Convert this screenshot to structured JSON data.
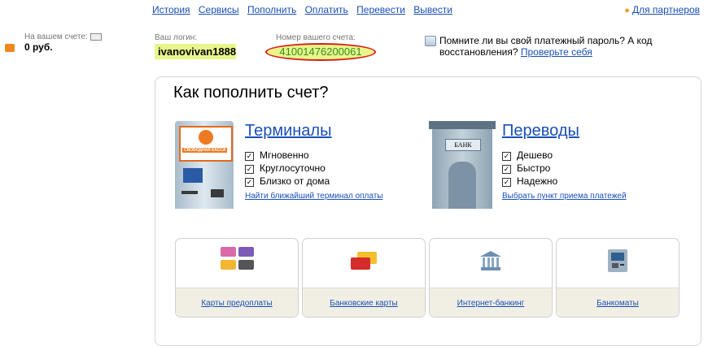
{
  "topnav": {
    "items": [
      "История",
      "Сервисы",
      "Пополнить",
      "Оплатить",
      "Перевести",
      "Вывести"
    ],
    "partners": "Для партнеров"
  },
  "balance": {
    "label": "На вашем счете:",
    "amount": "0 руб."
  },
  "login": {
    "label": "Ваш логин:",
    "value": "ivanovivan1888"
  },
  "account": {
    "label": "Номер вашего счета:",
    "value": "41001476200061"
  },
  "reminder": {
    "text": "Помните ли вы свой платежный пароль? А код восстановления?",
    "link": "Проверьте себя"
  },
  "panel": {
    "title": "Как пополнить счет?",
    "terminals": {
      "title": "Терминалы",
      "brand": "СВОБОДНАЯ КАССА",
      "features": [
        "Мгновенно",
        "Круглосуточно",
        "Близко от дома"
      ],
      "link": "Найти ближайший терминал оплаты"
    },
    "transfers": {
      "title": "Переводы",
      "sign": "БАНК",
      "features": [
        "Дешево",
        "Быстро",
        "Надежно"
      ],
      "link": "Выбрать пункт приема платежей"
    },
    "tiles": [
      "Карты предоплаты",
      "Банковские карты",
      "Интернет-банкинг",
      "Банкоматы"
    ]
  },
  "colors": {
    "link": "#1a4fb6",
    "highlight": "#e9f58a",
    "circle": "#d61a1a",
    "account_text": "#2e8f1f",
    "accent_orange": "#f0861e"
  }
}
